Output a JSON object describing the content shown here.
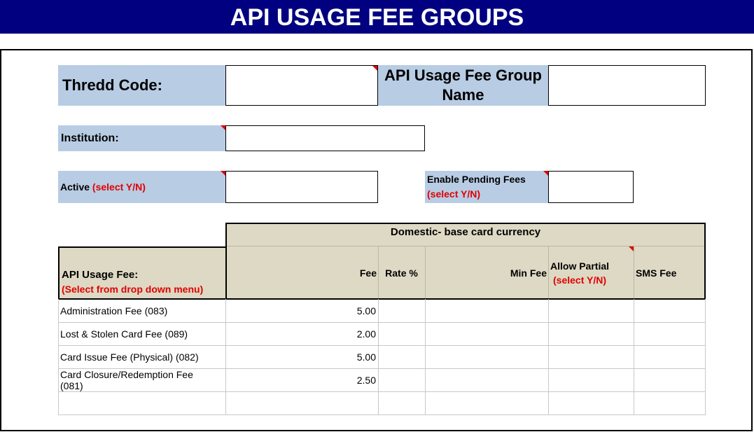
{
  "page_title": "API USAGE FEE GROUPS",
  "form": {
    "thredd_code_label": "Thredd Code:",
    "thredd_code_value": "",
    "group_name_label": "API Usage Fee Group Name",
    "group_name_value": "",
    "institution_label": "Institution:",
    "institution_value": "",
    "active_label": "Active",
    "active_hint": "(select Y/N)",
    "active_value": "",
    "pending_label": "Enable Pending Fees",
    "pending_hint": "(select Y/N)",
    "pending_value": ""
  },
  "table": {
    "group_header": "Domestic- base card currency",
    "fee_col_label": "API Usage Fee:",
    "fee_col_hint": "(Select from drop down menu)",
    "columns": {
      "fee": "Fee",
      "rate": "Rate %",
      "min_fee": "Min Fee",
      "allow_partial": "Allow Partial",
      "allow_partial_hint": "(select Y/N)",
      "sms_fee": "SMS Fee"
    },
    "rows": [
      {
        "name": "Administration Fee (083)",
        "fee": "5.00",
        "rate": "",
        "min_fee": "",
        "allow_partial": "",
        "sms_fee": ""
      },
      {
        "name": "Lost & Stolen Card Fee (089)",
        "fee": "2.00",
        "rate": "",
        "min_fee": "",
        "allow_partial": "",
        "sms_fee": ""
      },
      {
        "name": "Card Issue Fee (Physical)  (082)",
        "fee": "5.00",
        "rate": "",
        "min_fee": "",
        "allow_partial": "",
        "sms_fee": ""
      },
      {
        "name": "Card Closure/Redemption Fee (081)",
        "fee": "2.50",
        "rate": "",
        "min_fee": "",
        "allow_partial": "",
        "sms_fee": ""
      },
      {
        "name": "",
        "fee": "",
        "rate": "",
        "min_fee": "",
        "allow_partial": "",
        "sms_fee": ""
      }
    ]
  },
  "colors": {
    "banner": "#000080",
    "label_bg": "#b8cce4",
    "header_bg": "#ddd9c4",
    "hint_red": "#e00000"
  }
}
